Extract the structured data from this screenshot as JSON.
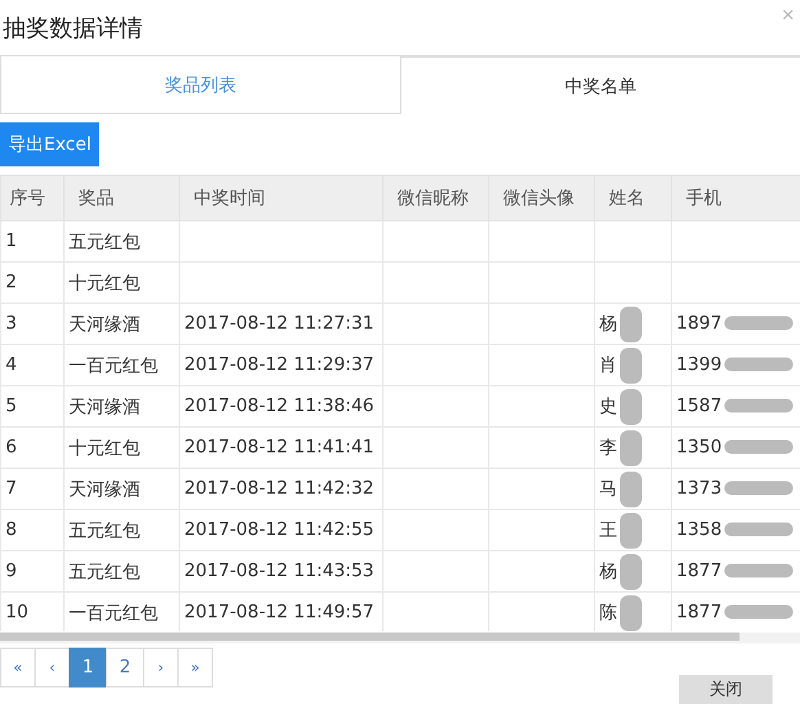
{
  "dialog": {
    "title": "抽奖数据详情",
    "close": "×"
  },
  "tabs": [
    {
      "label": "奖品列表",
      "selected": false
    },
    {
      "label": "中奖名单",
      "selected": true
    }
  ],
  "export_button": "导出Excel",
  "table": {
    "columns": [
      "序号",
      "奖品",
      "中奖时间",
      "微信昵称",
      "微信头像",
      "姓名",
      "手机"
    ],
    "rows": [
      {
        "cells": [
          "1",
          "五元红包",
          "",
          "",
          "",
          "",
          ""
        ],
        "redacted": false
      },
      {
        "cells": [
          "2",
          "十元红包",
          "",
          "",
          "",
          "",
          ""
        ],
        "redacted": false
      },
      {
        "cells": [
          "3",
          "天河缘酒",
          "2017-08-12 11:27:31",
          "",
          "",
          "杨",
          "1897"
        ],
        "redacted": true
      },
      {
        "cells": [
          "4",
          "一百元红包",
          "2017-08-12 11:29:37",
          "",
          "",
          "肖",
          "1399"
        ],
        "redacted": true
      },
      {
        "cells": [
          "5",
          "天河缘酒",
          "2017-08-12 11:38:46",
          "",
          "",
          "史",
          "1587"
        ],
        "redacted": true
      },
      {
        "cells": [
          "6",
          "十元红包",
          "2017-08-12 11:41:41",
          "",
          "",
          "李",
          "1350"
        ],
        "redacted": true
      },
      {
        "cells": [
          "7",
          "天河缘酒",
          "2017-08-12 11:42:32",
          "",
          "",
          "马",
          "1373"
        ],
        "redacted": true
      },
      {
        "cells": [
          "8",
          "五元红包",
          "2017-08-12 11:42:55",
          "",
          "",
          "王",
          "1358"
        ],
        "redacted": true
      },
      {
        "cells": [
          "9",
          "五元红包",
          "2017-08-12 11:43:53",
          "",
          "",
          "杨",
          "1877"
        ],
        "redacted": true
      },
      {
        "cells": [
          "10",
          "一百元红包",
          "2017-08-12 11:49:57",
          "",
          "",
          "陈",
          "1877"
        ],
        "redacted": true
      }
    ]
  },
  "pagination": [
    {
      "label": "«",
      "selected": false
    },
    {
      "label": "‹",
      "selected": false
    },
    {
      "label": "1",
      "selected": true
    },
    {
      "label": "2",
      "selected": false
    },
    {
      "label": "›",
      "selected": false
    },
    {
      "label": "»",
      "selected": false
    }
  ],
  "footer_button": "关闭"
}
